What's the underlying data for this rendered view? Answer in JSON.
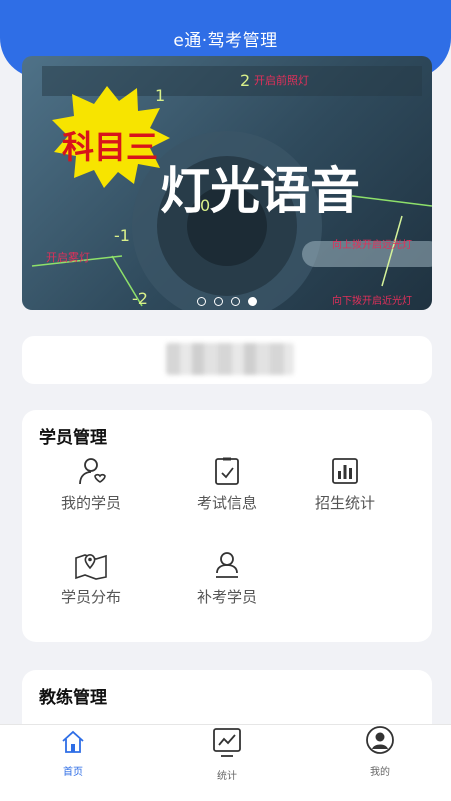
{
  "header": {
    "title": "e通·驾考管理"
  },
  "banner": {
    "badge_text": "科目三",
    "headline": "灯光语音",
    "overlay_labels": [
      "开启前照灯",
      "开启雾灯",
      "向上拨开启远光灯",
      "向下拨开启近光灯"
    ],
    "dial_numbers": [
      "0",
      "1",
      "2",
      "-1",
      "-2",
      "0"
    ],
    "slide_count": 4,
    "active_slide": 4
  },
  "student_section": {
    "title": "学员管理",
    "items": [
      {
        "label": "我的学员",
        "icon": "user-heart-icon"
      },
      {
        "label": "考试信息",
        "icon": "clipboard-check-icon"
      },
      {
        "label": "招生统计",
        "icon": "bar-chart-icon"
      },
      {
        "label": "学员分布",
        "icon": "map-pin-icon"
      },
      {
        "label": "补考学员",
        "icon": "user-id-icon"
      }
    ]
  },
  "coach_section": {
    "title": "教练管理"
  },
  "tabbar": {
    "items": [
      {
        "label": "首页",
        "icon": "home-icon",
        "active": true
      },
      {
        "label": "统计",
        "icon": "chart-monitor-icon",
        "active": false
      },
      {
        "label": "我的",
        "icon": "profile-icon",
        "active": false
      }
    ]
  },
  "colors": {
    "brand": "#2f6ee6",
    "background": "#f1f2f6",
    "badge_yellow": "#f7e400",
    "badge_red": "#d8141b"
  }
}
